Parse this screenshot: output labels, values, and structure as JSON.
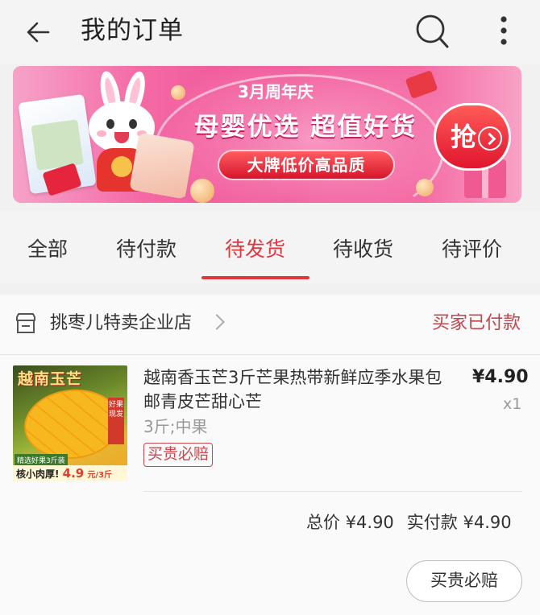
{
  "header": {
    "title": "我的订单",
    "back_icon": "arrow-left-icon",
    "search_icon": "search-icon",
    "more_icon": "more-vertical-icon"
  },
  "banner": {
    "caption": "3月周年庆",
    "headline": "母婴优选 超值好货",
    "pill": "大牌低价高品质",
    "cta": "抢",
    "accent_color": "#ef4e93"
  },
  "tabs": [
    {
      "label": "全部"
    },
    {
      "label": "待付款"
    },
    {
      "label": "待发货",
      "active": true
    },
    {
      "label": "待收货"
    },
    {
      "label": "待评价"
    }
  ],
  "order": {
    "shop_name": "挑枣儿特卖企业店",
    "status": "买家已付款",
    "product": {
      "title": "越南香玉芒3斤芒果热带新鲜应季水果包邮青皮芒甜心芒",
      "spec": "3斤;中果",
      "badge": "买贵必赔",
      "price": "¥4.90",
      "quantity": "x1",
      "image": {
        "top_text": "越南玉芒",
        "side_text": "好果现发",
        "tag": "精选好果3斤装",
        "bottom_prefix": "核小肉厚!",
        "bottom_price": "4.9",
        "bottom_unit": "元/3斤"
      }
    },
    "total_label": "总价 ¥4.90",
    "paid_label": "实付款 ¥4.90",
    "action_button": "买贵必赔"
  },
  "colors": {
    "accent_red": "#e0373f",
    "status_red": "#c3454c"
  }
}
